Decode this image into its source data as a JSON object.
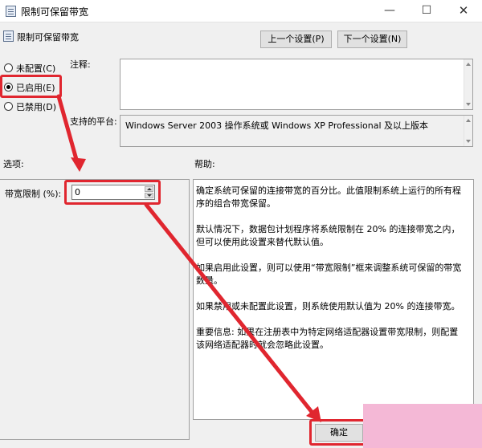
{
  "window": {
    "title": "限制可保留带宽",
    "min_glyph": "—",
    "max_glyph": "☐",
    "close_glyph": "✕"
  },
  "policy": {
    "name": "限制可保留带宽"
  },
  "nav": {
    "prev_label": "上一个设置(P)",
    "next_label": "下一个设置(N)"
  },
  "state": {
    "options": [
      {
        "label": "未配置(C)",
        "checked": false
      },
      {
        "label": "已启用(E)",
        "checked": true
      },
      {
        "label": "已禁用(D)",
        "checked": false
      }
    ]
  },
  "comment": {
    "label": "注释:",
    "value": ""
  },
  "platform": {
    "label": "支持的平台:",
    "value": "Windows Server 2003 操作系统或 Windows XP Professional 及以上版本"
  },
  "sections": {
    "options_label": "选项:",
    "help_label": "帮助:"
  },
  "bandwidth": {
    "label": "带宽限制 (%):",
    "value": "0"
  },
  "help": {
    "paragraphs": [
      "确定系统可保留的连接带宽的百分比。此值限制系统上运行的所有程序的组合带宽保留。",
      "默认情况下，数据包计划程序将系统限制在 20% 的连接带宽之内，但可以使用此设置来替代默认值。",
      "如果启用此设置，则可以使用“带宽限制”框来调整系统可保留的带宽数量。",
      "如果禁用或未配置此设置，则系统使用默认值为 20% 的连接带宽。",
      "重要信息: 如果在注册表中为特定网络适配器设置带宽限制，则配置该网络适配器时就会忽略此设置。"
    ]
  },
  "footer": {
    "ok_label": "确定"
  },
  "colors": {
    "annotation": "#e0262f",
    "overlay": "#f4b8d6"
  }
}
